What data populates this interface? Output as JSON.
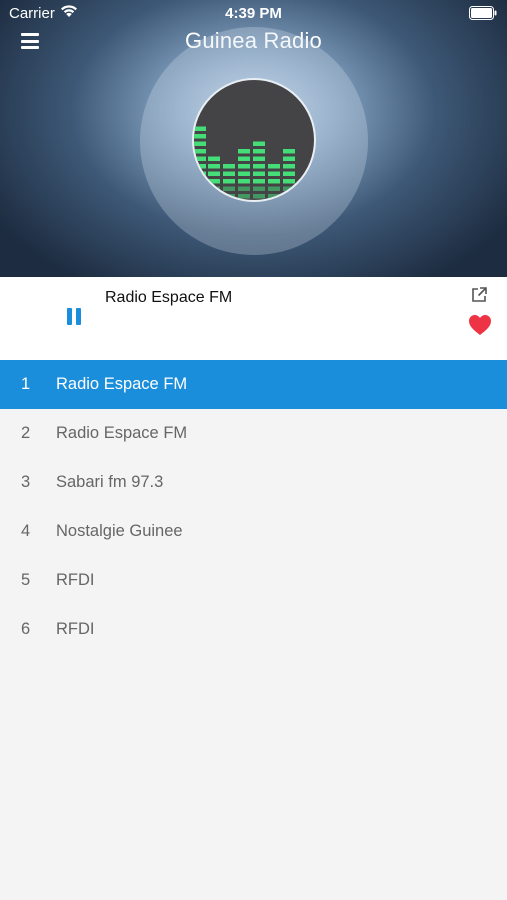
{
  "status_bar": {
    "carrier": "Carrier",
    "time": "4:39 PM"
  },
  "header": {
    "title": "Guinea Radio"
  },
  "now_playing": {
    "station": "Radio Espace FM",
    "state": "playing"
  },
  "stations": [
    {
      "num": "1",
      "name": "Radio Espace FM",
      "active": true
    },
    {
      "num": "2",
      "name": "Radio Espace FM",
      "active": false
    },
    {
      "num": "3",
      "name": "Sabari fm 97.3",
      "active": false
    },
    {
      "num": "4",
      "name": "Nostalgie Guinee",
      "active": false
    },
    {
      "num": "5",
      "name": "RFDI",
      "active": false
    },
    {
      "num": "6",
      "name": "RFDI",
      "active": false
    }
  ],
  "colors": {
    "accent": "#1a8ddb",
    "heart": "#ee3344",
    "equalizer": "#44dd77"
  }
}
